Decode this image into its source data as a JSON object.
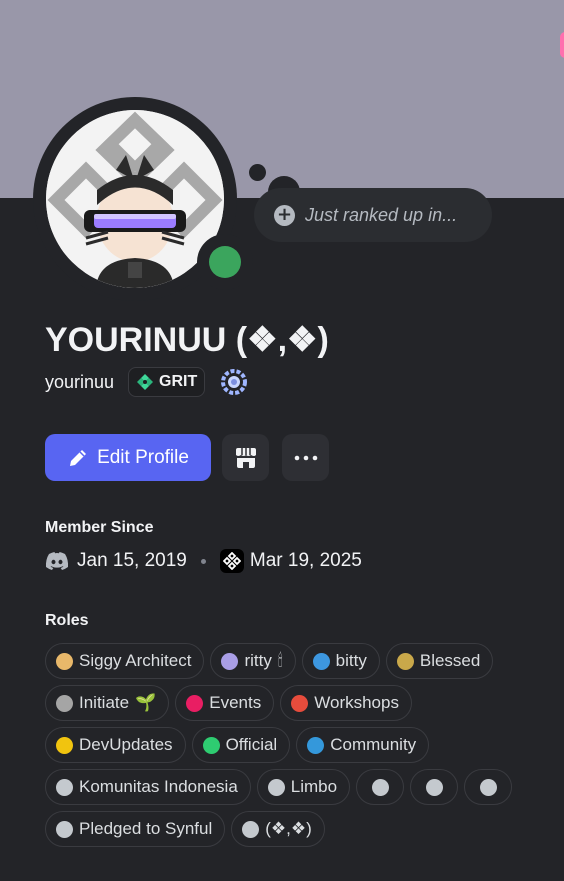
{
  "profile": {
    "display_name": "YOURINUU (❖,❖)",
    "username": "yourinuu",
    "guild_tag": "GRIT",
    "status": "online",
    "status_color": "#3ba55d",
    "banner_color": "#9997a9",
    "custom_status_placeholder": "Just ranked up in..."
  },
  "actions": {
    "edit_profile_label": "Edit Profile",
    "edit_icon": "pencil-icon",
    "shop_icon": "shop-icon",
    "more_icon": "more-icon",
    "accent": "#5865f2"
  },
  "member_since": {
    "heading": "Member Since",
    "discord_date": "Jan 15, 2019",
    "server_date": "Mar 19, 2025"
  },
  "roles": {
    "heading": "Roles",
    "items": [
      {
        "label": "Siggy Architect",
        "color": "#e8b86a",
        "extra": ""
      },
      {
        "label": "ritty",
        "color": "#a99ee6",
        "extra": "🕯"
      },
      {
        "label": "bitty",
        "color": "#3d97e0",
        "extra": ""
      },
      {
        "label": "Blessed",
        "color": "#c9a84a",
        "extra": ""
      },
      {
        "label": "Initiate",
        "color": "#a5a5a5",
        "extra": "🌱"
      },
      {
        "label": "Events",
        "color": "#e91e63",
        "extra": ""
      },
      {
        "label": "Workshops",
        "color": "#e74c3c",
        "extra": ""
      },
      {
        "label": "DevUpdates",
        "color": "#f1c40f",
        "extra": ""
      },
      {
        "label": "Official",
        "color": "#2ecc71",
        "extra": ""
      },
      {
        "label": "Community",
        "color": "#3498db",
        "extra": ""
      },
      {
        "label": "Komunitas Indonesia",
        "color": "#c4c9ce",
        "extra": ""
      },
      {
        "label": "Limbo",
        "color": "#c4c9ce",
        "extra": ""
      },
      {
        "label": "",
        "color": "#c4c9ce",
        "extra": ""
      },
      {
        "label": "",
        "color": "#c4c9ce",
        "extra": ""
      },
      {
        "label": "",
        "color": "#c4c9ce",
        "extra": ""
      },
      {
        "label": "Pledged to Synful",
        "color": "#c4c9ce",
        "extra": ""
      },
      {
        "label": "(❖,❖)",
        "color": "#c4c9ce",
        "extra": ""
      }
    ]
  }
}
